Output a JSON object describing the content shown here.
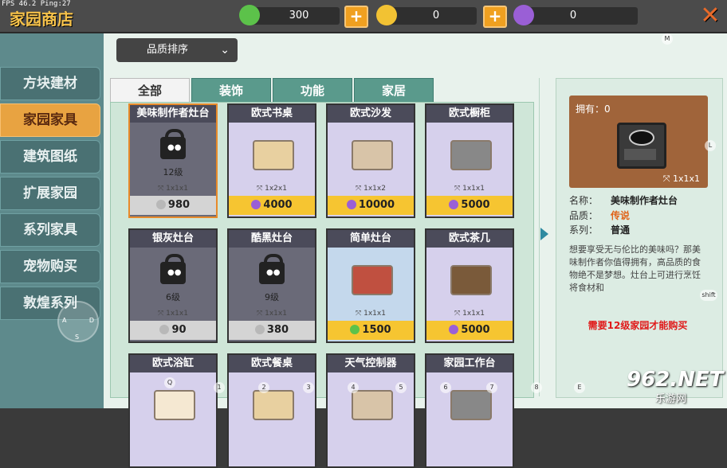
{
  "debug": {
    "fps": "FPS 46.2  Ping:27"
  },
  "header": {
    "title": "家园商店"
  },
  "currencies": [
    {
      "icon": "green-gem-icon",
      "value": "300",
      "color": "#5cc24a"
    },
    {
      "icon": "gold-coin-icon",
      "value": "0",
      "color": "#f2c233"
    },
    {
      "icon": "purple-gem-icon",
      "value": "0",
      "color": "#9a5fd6"
    }
  ],
  "sidebar": {
    "items": [
      {
        "label": "方块建材"
      },
      {
        "label": "家园家具",
        "active": true
      },
      {
        "label": "建筑图纸"
      },
      {
        "label": "扩展家园"
      },
      {
        "label": "系列家具"
      },
      {
        "label": "宠物购买"
      },
      {
        "label": "敦煌系列"
      }
    ]
  },
  "sort": {
    "label": "品质排序"
  },
  "tabs": [
    {
      "label": "全部",
      "active": true
    },
    {
      "label": "装饰"
    },
    {
      "label": "功能"
    },
    {
      "label": "家居"
    }
  ],
  "items": [
    {
      "name": "美味制作者灶台",
      "locked": true,
      "level": "12级",
      "size": "1x1x1",
      "price": "980",
      "price_style": "gray",
      "coin": "silver",
      "selected": true
    },
    {
      "name": "欧式书桌",
      "size": "1x2x1",
      "price": "4000",
      "price_style": "yellow",
      "coin": "purple"
    },
    {
      "name": "欧式沙发",
      "size": "1x1x2",
      "price": "10000",
      "price_style": "yellow",
      "coin": "purple"
    },
    {
      "name": "欧式橱柜",
      "size": "1x1x1",
      "price": "5000",
      "price_style": "yellow",
      "coin": "purple"
    },
    {
      "name": "银灰灶台",
      "locked": true,
      "level": "6级",
      "size": "1x1x1",
      "price": "90",
      "price_style": "gray",
      "coin": "silver"
    },
    {
      "name": "酷黑灶台",
      "locked": true,
      "level": "9级",
      "size": "1x1x1",
      "price": "380",
      "price_style": "gray",
      "coin": "silver"
    },
    {
      "name": "简单灶台",
      "size": "1x1x1",
      "price": "1500",
      "price_style": "yellow",
      "coin": "green"
    },
    {
      "name": "欧式茶几",
      "size": "1x1x1",
      "price": "5000",
      "price_style": "yellow",
      "coin": "purple"
    },
    {
      "name": "欧式浴缸"
    },
    {
      "name": "欧式餐桌"
    },
    {
      "name": "天气控制器"
    },
    {
      "name": "家园工作台"
    }
  ],
  "detail": {
    "owned": "拥有：0",
    "size": "1x1x1",
    "name_label": "名称：",
    "name": "美味制作者灶台",
    "quality_label": "品质：",
    "quality": "传说",
    "series_label": "系列：",
    "series": "普通",
    "description": "想要享受无与伦比的美味吗？那美味制作者你值得拥有，高品质的食物绝不是梦想。灶台上可进行烹饪　将食材和",
    "requirement": "需要12级家园才能购买"
  },
  "hints": [
    "M",
    "L",
    "shift",
    "Q",
    "1",
    "2",
    "3",
    "4",
    "5",
    "6",
    "7",
    "8",
    "E",
    "A",
    "D",
    "S"
  ],
  "watermark": {
    "brand": "962.NET",
    "sub": "乐游网"
  }
}
